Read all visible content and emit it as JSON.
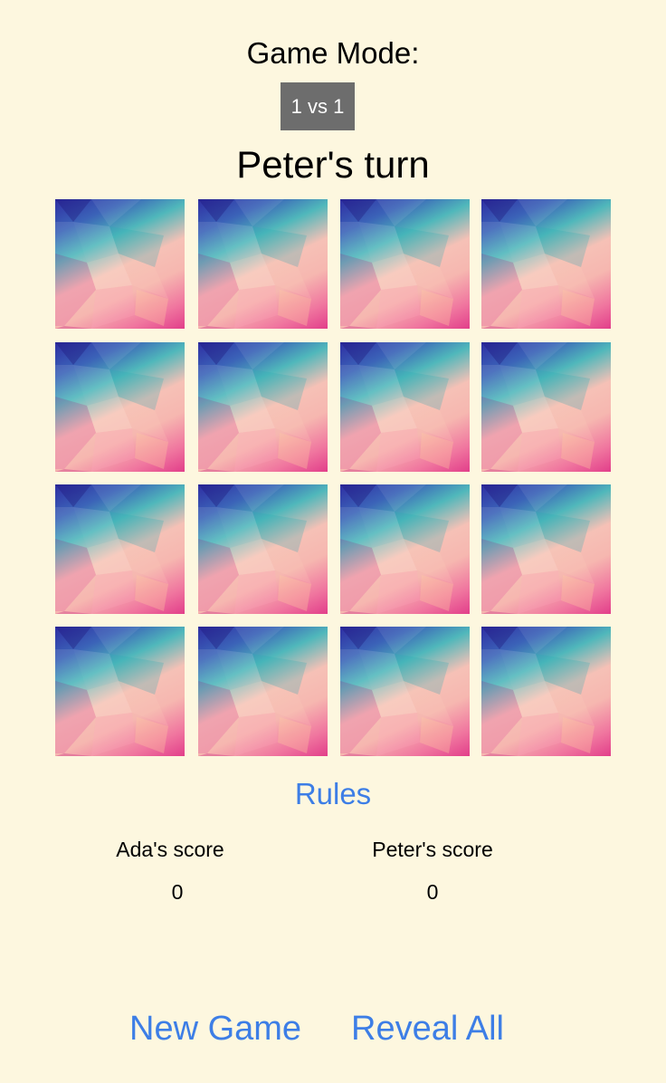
{
  "header": {
    "mode_label": "Game Mode:",
    "mode_value": "1 vs 1",
    "turn_text": "Peter's turn"
  },
  "board": {
    "rows": 4,
    "cols": 4,
    "cards": [
      {
        "state": "face-down"
      },
      {
        "state": "face-down"
      },
      {
        "state": "face-down"
      },
      {
        "state": "face-down"
      },
      {
        "state": "face-down"
      },
      {
        "state": "face-down"
      },
      {
        "state": "face-down"
      },
      {
        "state": "face-down"
      },
      {
        "state": "face-down"
      },
      {
        "state": "face-down"
      },
      {
        "state": "face-down"
      },
      {
        "state": "face-down"
      },
      {
        "state": "face-down"
      },
      {
        "state": "face-down"
      },
      {
        "state": "face-down"
      },
      {
        "state": "face-down"
      }
    ]
  },
  "links": {
    "rules": "Rules"
  },
  "scores": {
    "players": [
      {
        "label": "Ada's score",
        "value": "0"
      },
      {
        "label": "Peter's score",
        "value": "0"
      }
    ]
  },
  "actions": {
    "new_game": "New Game",
    "reveal_all": "Reveal All"
  },
  "colors": {
    "background": "#fdf7df",
    "accent": "#3d7ee6",
    "mode_button": "#6d6d6d"
  }
}
